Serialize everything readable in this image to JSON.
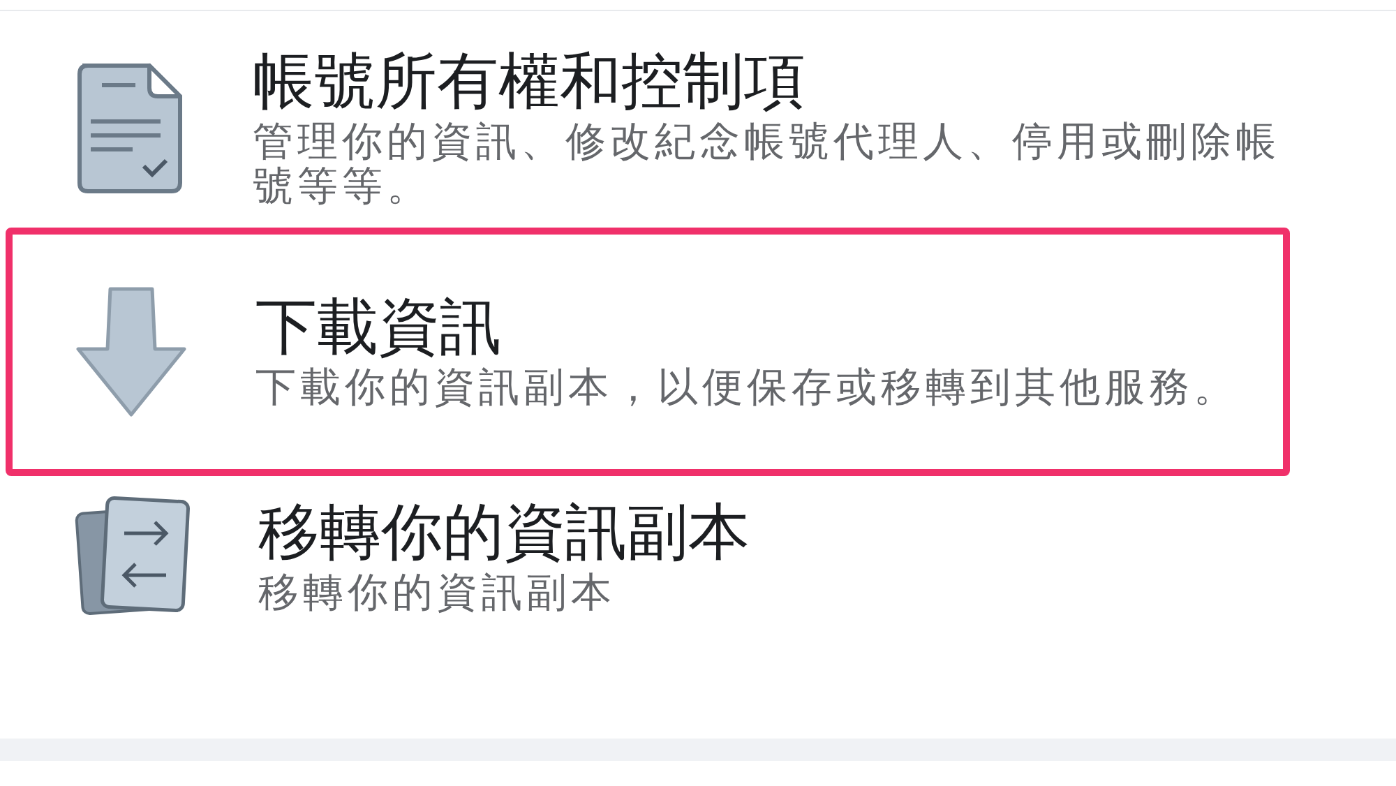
{
  "items": [
    {
      "kind": "document",
      "title": "帳號所有權和控制項",
      "subtitle": "管理你的資訊、修改紀念帳號代理人、停用或刪除帳號等等。",
      "highlighted": false
    },
    {
      "kind": "download",
      "title": "下載資訊",
      "subtitle": "下載你的資訊副本，以便保存或移轉到其他服務。",
      "highlighted": true
    },
    {
      "kind": "transfer",
      "title": "移轉你的資訊副本",
      "subtitle": "移轉你的資訊副本",
      "highlighted": false
    }
  ]
}
